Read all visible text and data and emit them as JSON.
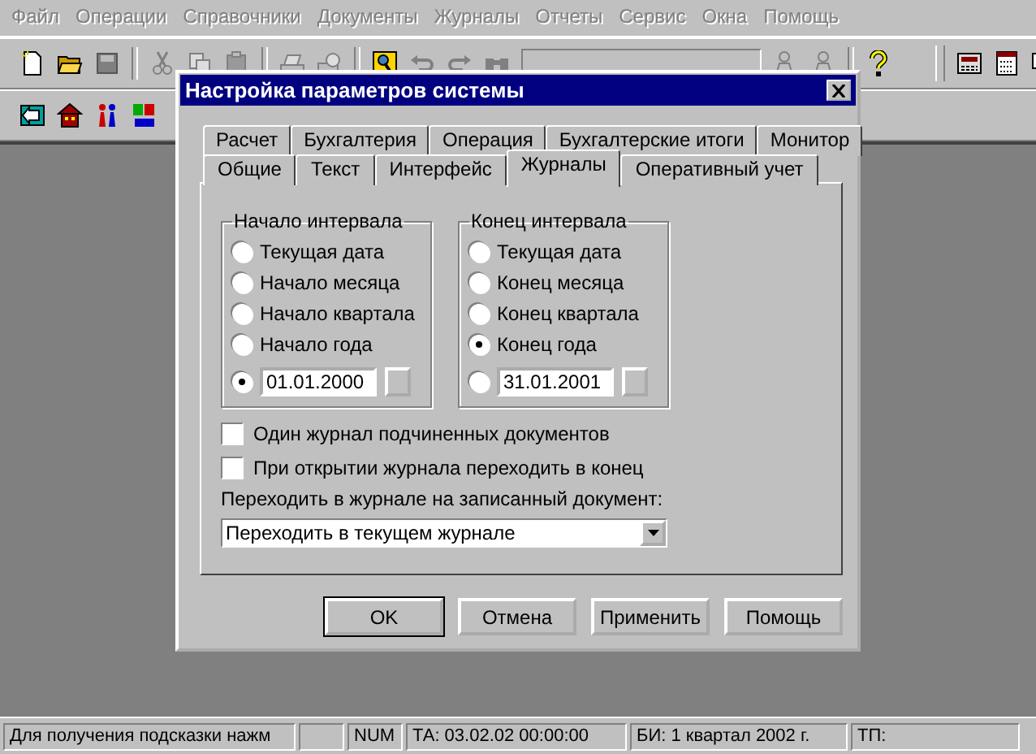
{
  "menu": [
    {
      "label": "Файл",
      "disabled": true
    },
    {
      "label": "Операции",
      "disabled": true
    },
    {
      "label": "Справочники",
      "disabled": true
    },
    {
      "label": "Документы",
      "disabled": true
    },
    {
      "label": "Журналы",
      "disabled": true
    },
    {
      "label": "Отчеты",
      "disabled": true
    },
    {
      "label": "Сервис",
      "disabled": true
    },
    {
      "label": "Окна",
      "disabled": true
    },
    {
      "label": "Помощь",
      "disabled": true
    }
  ],
  "dialog": {
    "title": "Настройка параметров системы",
    "tab_rows": [
      [
        {
          "label": "Расчет",
          "selected": false
        },
        {
          "label": "Бухгалтерия",
          "selected": false
        },
        {
          "label": "Операция",
          "selected": false
        },
        {
          "label": "Бухгалтерские итоги",
          "selected": false
        },
        {
          "label": "Монитор",
          "selected": false
        }
      ],
      [
        {
          "label": "Общие",
          "selected": false
        },
        {
          "label": "Текст",
          "selected": false
        },
        {
          "label": "Интерфейс",
          "selected": false
        },
        {
          "label": "Журналы",
          "selected": true
        },
        {
          "label": "Оперативный учет",
          "selected": false
        }
      ]
    ],
    "groups": [
      {
        "title": "Начало интервала",
        "options": [
          {
            "kind": "option",
            "label": "Текущая дата",
            "selected": false
          },
          {
            "kind": "option",
            "label": "Начало месяца",
            "selected": false
          },
          {
            "kind": "option",
            "label": "Начало квартала",
            "selected": false
          },
          {
            "kind": "option",
            "label": "Начало года",
            "selected": false
          },
          {
            "kind": "date",
            "value": "01.01.2000",
            "selected": true
          }
        ]
      },
      {
        "title": "Конец интервала",
        "options": [
          {
            "kind": "option",
            "label": "Текущая дата",
            "selected": false
          },
          {
            "kind": "option",
            "label": "Конец месяца",
            "selected": false
          },
          {
            "kind": "option",
            "label": "Конец квартала",
            "selected": false
          },
          {
            "kind": "option",
            "label": "Конец года",
            "selected": true
          },
          {
            "kind": "date",
            "value": "31.01.2001",
            "selected": false
          }
        ]
      }
    ],
    "checkboxes": [
      {
        "label": "Один журнал подчиненных документов",
        "checked": false
      },
      {
        "label": "При открытии журнала переходить в конец",
        "checked": false
      }
    ],
    "dropdown_label": "Переходить в журнале на записанный документ:",
    "dropdown": {
      "value": "Переходить в текущем журнале"
    },
    "buttons": [
      {
        "label": "OK",
        "default": true
      },
      {
        "label": "Отмена",
        "default": false
      },
      {
        "label": "Применить",
        "default": false
      },
      {
        "label": "Помощь",
        "default": false
      }
    ]
  },
  "status_bar": [
    "Для получения подсказки нажм",
    "NUM",
    "ТА: 03.02.02  00:00:00",
    "БИ: 1 квартал 2002 г.",
    "ТП:"
  ]
}
